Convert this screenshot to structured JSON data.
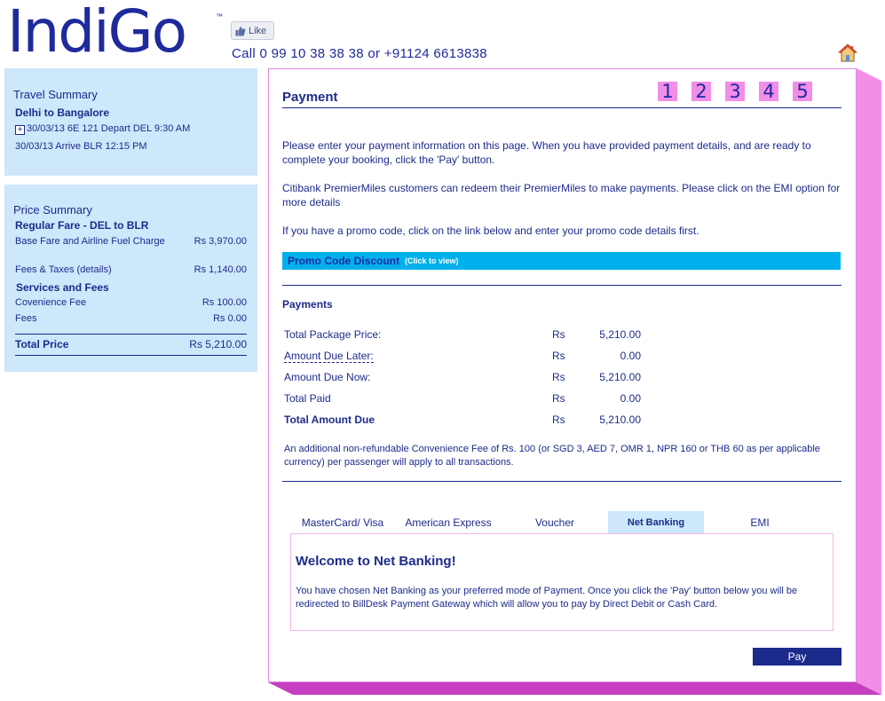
{
  "brand": {
    "logo": "IndiGo",
    "tm": "™",
    "like_label": "Like",
    "call_text": "Call 0 99 10 38 38 38 or +91124 6613838"
  },
  "colors": {
    "brand_blue": "#1f2a9c",
    "panel_blue": "#cde7fb",
    "accent_pink": "#f28de8",
    "promo_cyan": "#00b0ec",
    "button_navy": "#1c2a8c"
  },
  "icons": {
    "like": "thumbs-up-icon",
    "home": "home-icon",
    "expand": "plus-box-icon"
  },
  "travel_summary": {
    "title": "Travel Summary",
    "route": "Delhi to Bangalore",
    "depart": "30/03/13 6E 121 Depart DEL 9:30 AM",
    "arrive": "30/03/13 Arrive BLR 12:15 PM"
  },
  "price_summary": {
    "title": "Price Summary",
    "fare_type": "Regular Fare - DEL to BLR",
    "base_fare_label": "Base Fare and Airline Fuel Charge",
    "base_fare_value": "Rs 3,970.00",
    "fees_taxes_label": "Fees & Taxes (details)",
    "fees_taxes_value": "Rs 1,140.00",
    "services_heading": "Services and Fees",
    "convenience_label": "Covenience Fee",
    "convenience_value": "Rs 100.00",
    "fees_label": "Fees",
    "fees_value": "Rs 0.00",
    "total_label": "Total Price",
    "total_value": "Rs 5,210.00"
  },
  "payment": {
    "title": "Payment",
    "steps": [
      "1",
      "2",
      "3",
      "4",
      "5"
    ],
    "intro": "Please enter your payment information on this page. When you have provided payment details, and are ready to complete your booking, click the 'Pay' button.",
    "citibank": "Citibank PremierMiles customers can redeem their PremierMiles to make payments. Please click on the EMI option for more details",
    "promo_note": "If you have a promo code, click on the link below and enter your promo code details first.",
    "promo_label": "Promo Code Discount",
    "promo_hint": "(Click to view)",
    "payments_heading": "Payments",
    "rows": [
      {
        "label": "Total Package Price:",
        "currency": "Rs",
        "amount": "5,210.00"
      },
      {
        "label": "Amount Due Later:",
        "currency": "Rs",
        "amount": "0.00"
      },
      {
        "label": "Amount Due Now:",
        "currency": "Rs",
        "amount": "5,210.00"
      },
      {
        "label": "Total Paid",
        "currency": "Rs",
        "amount": "0.00"
      },
      {
        "label": "Total Amount Due",
        "currency": "Rs",
        "amount": "5,210.00"
      }
    ],
    "fee_note": "An additional non-refundable Convenience Fee of Rs. 100 (or SGD 3, AED 7, OMR 1, NPR 160 or THB 60 as per applicable currency) per passenger will apply to all transactions.",
    "tabs": [
      "MasterCard/ Visa",
      "American Express",
      "Voucher",
      "Net Banking",
      "EMI"
    ],
    "selected_tab": "Net Banking",
    "nb_title": "Welcome to Net Banking!",
    "nb_text": "You have chosen Net Banking as your preferred mode of Payment. Once you click the 'Pay' button below you will be redirected to BillDesk Payment Gateway which will allow you to pay by Direct Debit or Cash Card.",
    "pay_label": "Pay"
  }
}
